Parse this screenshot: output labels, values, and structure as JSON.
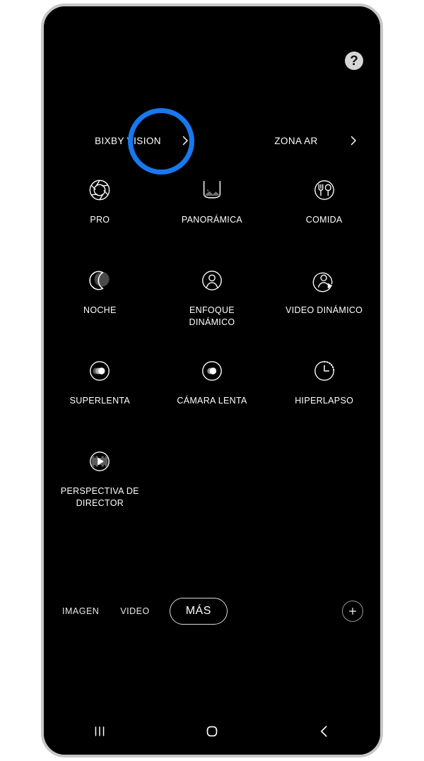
{
  "frame": {
    "device": "smartphone-frame"
  },
  "header": {
    "help_label": "?"
  },
  "shortcuts": [
    {
      "label": "BIXBY VISION",
      "arrow": "chevron-right-icon",
      "annotated": true
    },
    {
      "label": "ZONA AR",
      "arrow": "chevron-right-icon",
      "annotated": false
    }
  ],
  "annotation": {
    "shape": "circle",
    "color": "#1878f0",
    "target": "BIXBY VISION"
  },
  "modes": [
    {
      "label": "PRO",
      "icon": "aperture-icon"
    },
    {
      "label": "PANORÁMICA",
      "icon": "panorama-icon"
    },
    {
      "label": "COMIDA",
      "icon": "food-icon"
    },
    {
      "label": "NOCHE",
      "icon": "moon-icon"
    },
    {
      "label": "ENFOQUE DINÁMICO",
      "icon": "portrait-person-icon"
    },
    {
      "label": "VIDEO DINÁMICO",
      "icon": "portrait-video-icon"
    },
    {
      "label": "SUPERLENTA",
      "icon": "super-slow-motion-icon"
    },
    {
      "label": "CÁMARA LENTA",
      "icon": "slow-motion-icon"
    },
    {
      "label": "HIPERLAPSO",
      "icon": "hyperlapse-clock-icon"
    },
    {
      "label": "PERSPECTIVA DE DIRECTOR",
      "icon": "director-view-icon"
    }
  ],
  "tabs": [
    {
      "label": "IMAGEN",
      "selected": false
    },
    {
      "label": "VIDEO",
      "selected": false
    },
    {
      "label": "MÁS",
      "selected": true
    }
  ],
  "add_button": {
    "icon": "plus-icon"
  },
  "navigation": [
    {
      "name": "recents",
      "icon": "recents-icon"
    },
    {
      "name": "home",
      "icon": "home-icon"
    },
    {
      "name": "back",
      "icon": "back-icon"
    }
  ],
  "colors": {
    "accent": "#1878f0",
    "screen_background": "#000000",
    "frame_border": "#c6c6c6",
    "text": "#ffffff"
  }
}
